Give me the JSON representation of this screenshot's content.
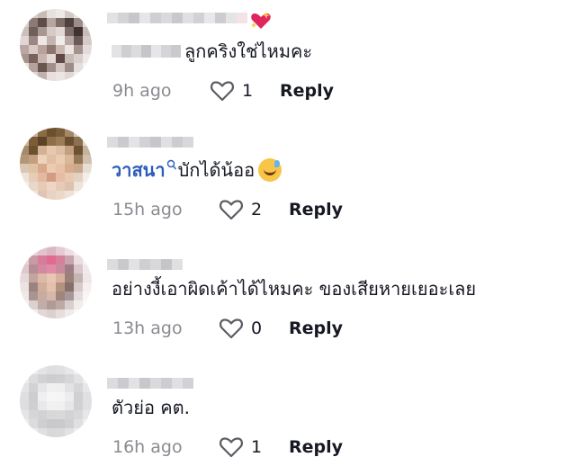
{
  "comments": [
    {
      "text": "ลูกคริงใช่ไหมคะ",
      "mention": "",
      "time": "9h ago",
      "likes": "1",
      "reply_label": "Reply",
      "username_blurred": true,
      "has_sparkle_heart": true
    },
    {
      "text": "บักได้น้ออ",
      "mention": "วาสนา",
      "time": "15h ago",
      "likes": "2",
      "reply_label": "Reply",
      "username_blurred": true,
      "emoji": "sweat-smile-emoji"
    },
    {
      "text": "อย่างงี้เอาผิดเค้าได้ไหมคะ ของเสียหายเยอะเลย",
      "mention": "",
      "time": "13h ago",
      "likes": "0",
      "reply_label": "Reply",
      "username_blurred": true
    },
    {
      "text": "ตัวย่อ คต.",
      "mention": "",
      "time": "16h ago",
      "likes": "1",
      "reply_label": "Reply",
      "username_blurred": true
    }
  ],
  "colors": {
    "mention": "#2b5db9",
    "time": "#8a8b91",
    "text": "#161823"
  }
}
